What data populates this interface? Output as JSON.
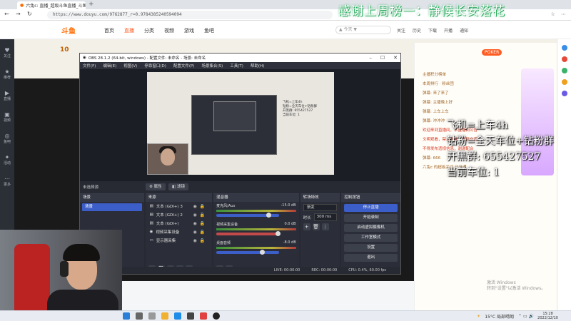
{
  "browser": {
    "tab_title": "六兔c: 直播_超级斗鱼直播_斗鱼直播",
    "url": "https://www.douyu.com/9762877_r=0.9784385240594094",
    "new_tab": "+"
  },
  "site": {
    "logo": "斗鱼",
    "nav": [
      "首页",
      "直播",
      "分类",
      "视频",
      "游戏",
      "鱼吧"
    ],
    "nav_active_index": 1,
    "search_placeholder": "▲ 今天 ▼",
    "header_icons": [
      "关注",
      "历史",
      "下载",
      "开播",
      "通知"
    ],
    "level": "10",
    "live_badge": "POKER",
    "sidebar": [
      "关注",
      "推荐",
      "直播",
      "视频",
      "鱼吧",
      "活动",
      "更多"
    ]
  },
  "chat": {
    "lines": [
      {
        "text": "主播积分榜单",
        "red": false
      },
      {
        "text": "本周排行 · 粉丝团",
        "red": false
      },
      {
        "text": "弹幕: 来了来了",
        "red": false
      },
      {
        "text": "弹幕: 主播晚上好",
        "red": false
      },
      {
        "text": "弹幕: 上车上车",
        "red": false
      },
      {
        "text": "弹幕: 冲冲冲",
        "red": false
      },
      {
        "text": "欢迎来到直播间，本直播间公告",
        "red": true
      },
      {
        "text": "文明观看，禁止刷屏，理性交流",
        "red": true
      },
      {
        "text": "不得发布违规信息，谢谢配合",
        "red": true
      },
      {
        "text": "弹幕: 666",
        "red": false
      },
      {
        "text": "六兔c 的超级关注 已开通",
        "red": false
      }
    ]
  },
  "obs": {
    "title": "OBS 28.1.2 (64-bit, windows) - 配置文件: 未命名 - 场景: 未命名",
    "menu": [
      "文件(F)",
      "编辑(E)",
      "视图(V)",
      "停靠窗口(D)",
      "配置文件(P)",
      "场景集合(S)",
      "工具(T)",
      "帮助(H)"
    ],
    "no_source": "未选择源",
    "props_btn": "⚙ 属性",
    "filters_btn": "◧ 滤镜",
    "preview_chat": [
      "飞机=上车4h",
      "钻粉=全天车位+钻粉群",
      "开黑群: 655427527",
      "当前车位: 1"
    ],
    "docks": {
      "scenes": {
        "title": "场景",
        "items": [
          "场景"
        ]
      },
      "sources": {
        "title": "来源",
        "items": [
          "文本 (GDI+) 3",
          "文本 (GDI+) 2",
          "文本 (GDI+)",
          "视频采集设备",
          "显示器采集"
        ]
      },
      "mixer": {
        "title": "混音器",
        "channels": [
          {
            "name": "麦克风/Aux",
            "db": "-15.0 dB",
            "level": 0.8,
            "muted": false
          },
          {
            "name": "视频采集设备",
            "db": "0.0 dB",
            "level": 0.95,
            "muted": true
          },
          {
            "name": "桌面音频",
            "db": "-8.0 dB",
            "level": 0.7,
            "muted": false
          }
        ]
      },
      "transitions": {
        "title": "转场特效",
        "type": "渐变",
        "duration_label": "时长",
        "duration": "300 ms"
      },
      "controls": {
        "title": "控制按钮",
        "buttons": [
          "停止直播",
          "开始录制",
          "启动虚拟摄像机",
          "工作室模式",
          "设置",
          "退出"
        ]
      }
    },
    "status": {
      "live": "LIVE: 00:00:00",
      "rec": "REC: 00:00:00",
      "cpu": "CPU: 0.4%, 60.00 fps"
    }
  },
  "overlays": {
    "top": "感谢上周榜一：静候长安落花",
    "right": [
      "飞机=上车4h",
      "钻粉=全天车位+钻粉群",
      "开黑群: 655427527",
      "当前车位: 1"
    ]
  },
  "taskbar": {
    "weather": "15°C 局部晴朗",
    "time": "15:28",
    "date": "2022/12/10",
    "watermark": [
      "激活 Windows",
      "转到\"设置\"以激活 Windows。"
    ]
  },
  "colors": {
    "accent": "#3c5ec8",
    "brand": "#ff5d23"
  }
}
